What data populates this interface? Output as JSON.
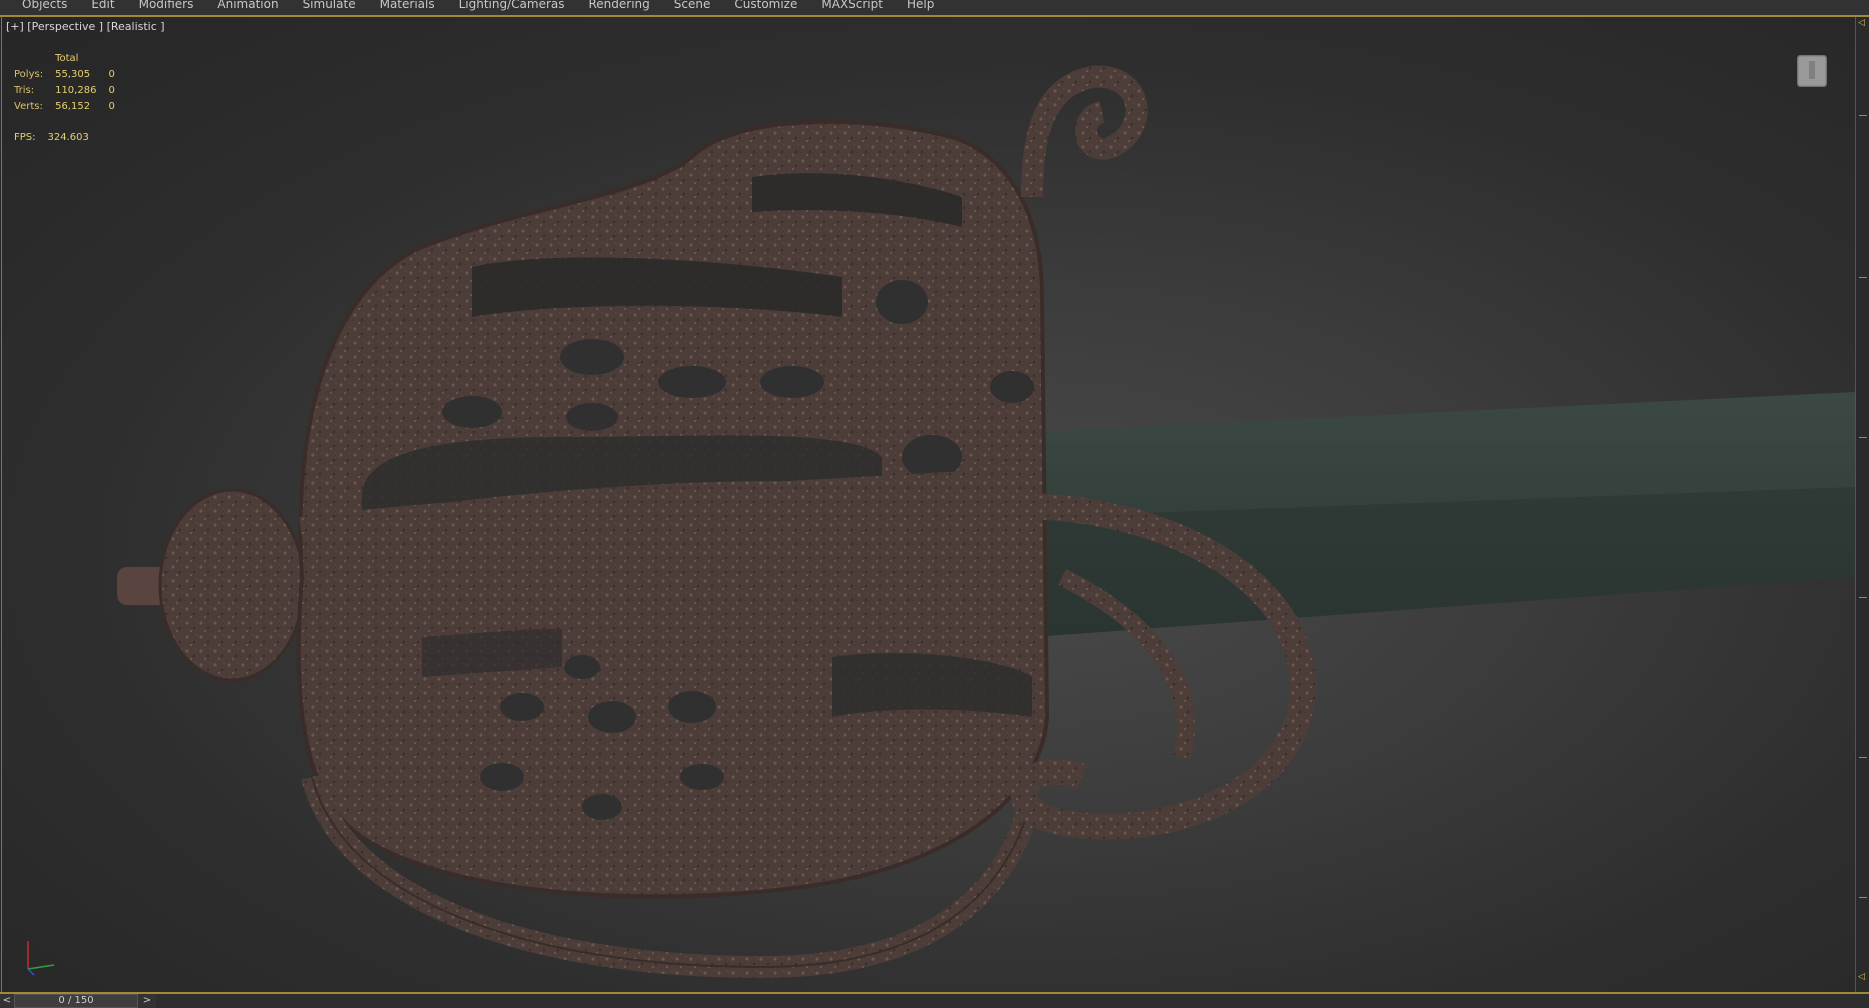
{
  "menu": {
    "items": [
      "Objects",
      "Edit",
      "Modifiers",
      "Animation",
      "Simulate",
      "Materials",
      "Lighting/Cameras",
      "Rendering",
      "Scene",
      "Customize",
      "MAXScript",
      "Help"
    ]
  },
  "viewport": {
    "label": "[+] [Perspective ] [Realistic ]",
    "stats": {
      "header": "Total",
      "rows": [
        {
          "label": "Polys:",
          "total": "55,305",
          "selected": "0"
        },
        {
          "label": "Tris:",
          "total": "110,286",
          "selected": "0"
        },
        {
          "label": "Verts:",
          "total": "56,152",
          "selected": "0"
        }
      ],
      "fps_label": "FPS:",
      "fps_value": "324.603"
    }
  },
  "timeline": {
    "prev": "<",
    "frame": "0 / 150",
    "next": ">"
  },
  "colors": {
    "accent": "#a08a3a",
    "stats_text": "#e6d070",
    "rust": "#4a3a36",
    "blade": "#2e3a36"
  }
}
